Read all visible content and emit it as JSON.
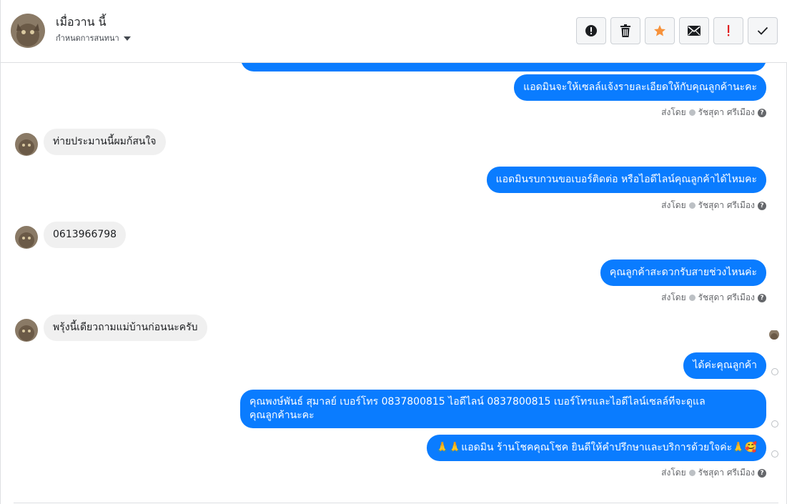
{
  "header": {
    "title": "เมื่อวาน นี้",
    "subtitle": "กำหนดการสนทนา",
    "actions": [
      {
        "name": "report-button",
        "icon": "exclamation-circle-icon"
      },
      {
        "name": "delete-button",
        "icon": "trash-icon"
      },
      {
        "name": "star-button",
        "icon": "star-icon"
      },
      {
        "name": "mail-button",
        "icon": "envelope-icon"
      },
      {
        "name": "important-button",
        "icon": "exclamation-icon"
      },
      {
        "name": "done-button",
        "icon": "check-icon"
      }
    ]
  },
  "messages": {
    "m1": "แอดมินจะให้เซลล์แจ้งรายละเอียดให้กับคุณลูกค้านะคะ",
    "m2": "ท่ายประมานนี้ผมก้สนใจ",
    "m3": "แอดมินรบกวนขอเบอร์ติดต่อ หรือไอดีไลน์คุณลูกค้าได้ไหมคะ",
    "m4": "0613966798",
    "m5": "คุณลูกค้าสะดวกรับสายช่วงไหนค่ะ",
    "m6": "พรุ้งนี้เดียวถามแม่บ้านก่อนนะครับ",
    "m7": "ได้ค่ะคุณลูกค้า",
    "m8_line1": "คุณพงษ์พันธ์ สุมาลย์      เบอร์โทร 0837800815  ไอดีไลน์ 0837800815  เบอร์โทรและไอดีไลน์เซลล์ที่จะดูแล",
    "m8_line2": "คุณลูกค้านะคะ",
    "m9": "🙏🙏แอดมิน ร้านโชคคุณโชค ยินดีให้คำปรึกษาและบริการด้วยใจค่ะ🙏🥰"
  },
  "meta": {
    "sent_by": "ส่งโดย",
    "agent": "รัชสุดา ศรีเมือง"
  },
  "colors": {
    "bubble_out": "#0a7cff",
    "bubble_in": "#f0f0f0",
    "star": "#f7923b",
    "important": "#e02020"
  }
}
